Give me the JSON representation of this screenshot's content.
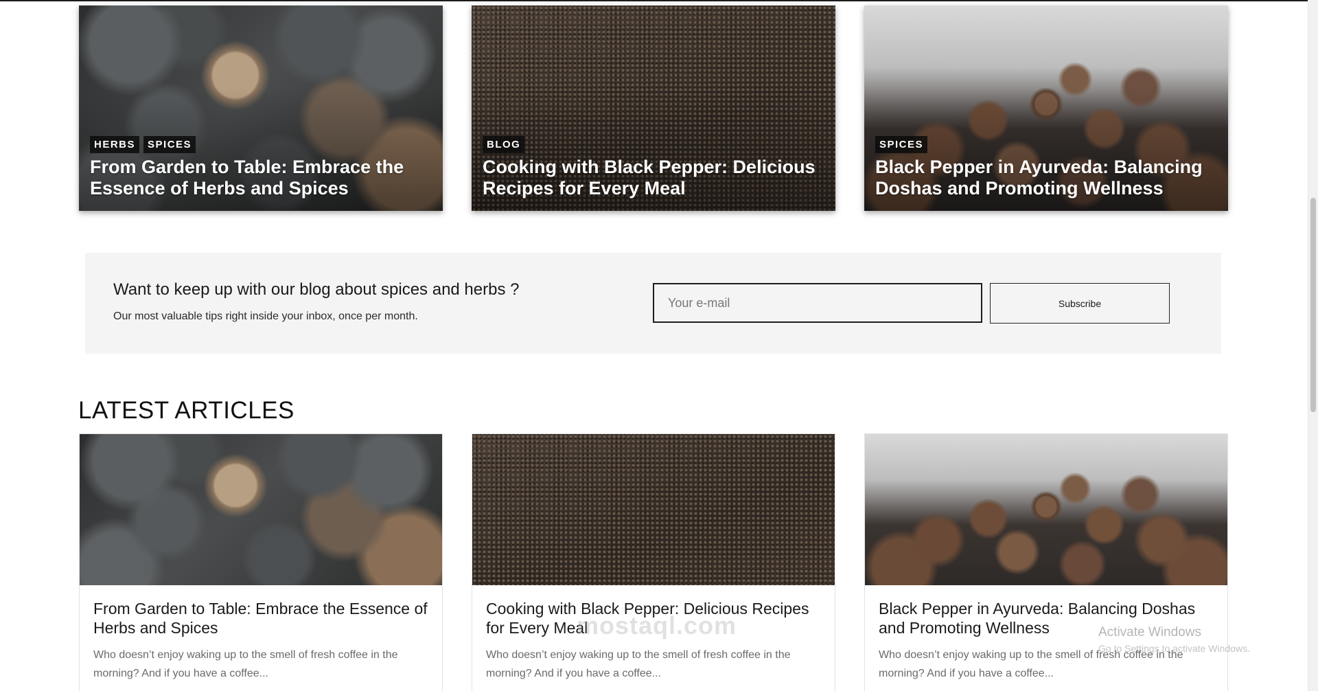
{
  "featured": [
    {
      "tags": [
        "HERBS",
        "SPICES"
      ],
      "title": "From Garden to Table: Embrace the Essence of Herbs and Spices",
      "image": "pepper"
    },
    {
      "tags": [
        "BLOG"
      ],
      "title": "Cooking with Black Pepper: Delicious Recipes for Every Meal",
      "image": "seeds"
    },
    {
      "tags": [
        "SPICES"
      ],
      "title": "Black Pepper in Ayurveda: Balancing Doshas and Promoting Wellness",
      "image": "allspice"
    }
  ],
  "newsletter": {
    "heading": "Want to keep up with our blog about spices and herbs ?",
    "subtext": "Our most valuable tips right inside your inbox, once per month.",
    "email_placeholder": "Your e-mail",
    "subscribe_label": "Subscribe"
  },
  "latest": {
    "heading": "LATEST ARTICLES",
    "articles": [
      {
        "title": "From Garden to Table: Embrace the Essence of Herbs and Spices",
        "excerpt": "Who doesn’t enjoy waking up to the smell of fresh coffee in the morning? And if you have a coffee...",
        "image": "pepper"
      },
      {
        "title": "Cooking with Black Pepper: Delicious Recipes for Every Meal",
        "excerpt": "Who doesn’t enjoy waking up to the smell of fresh coffee in the morning? And if you have a coffee...",
        "image": "seeds"
      },
      {
        "title": "Black Pepper in Ayurveda: Balancing Doshas and Promoting Wellness",
        "excerpt": "Who doesn’t enjoy waking up to the smell of fresh coffee in the morning? And if you have a coffee...",
        "image": "allspice"
      }
    ]
  },
  "watermarks": {
    "brand": "mostaql.com",
    "activate_title": "Activate Windows",
    "activate_sub": "Go to Settings to activate Windows."
  }
}
